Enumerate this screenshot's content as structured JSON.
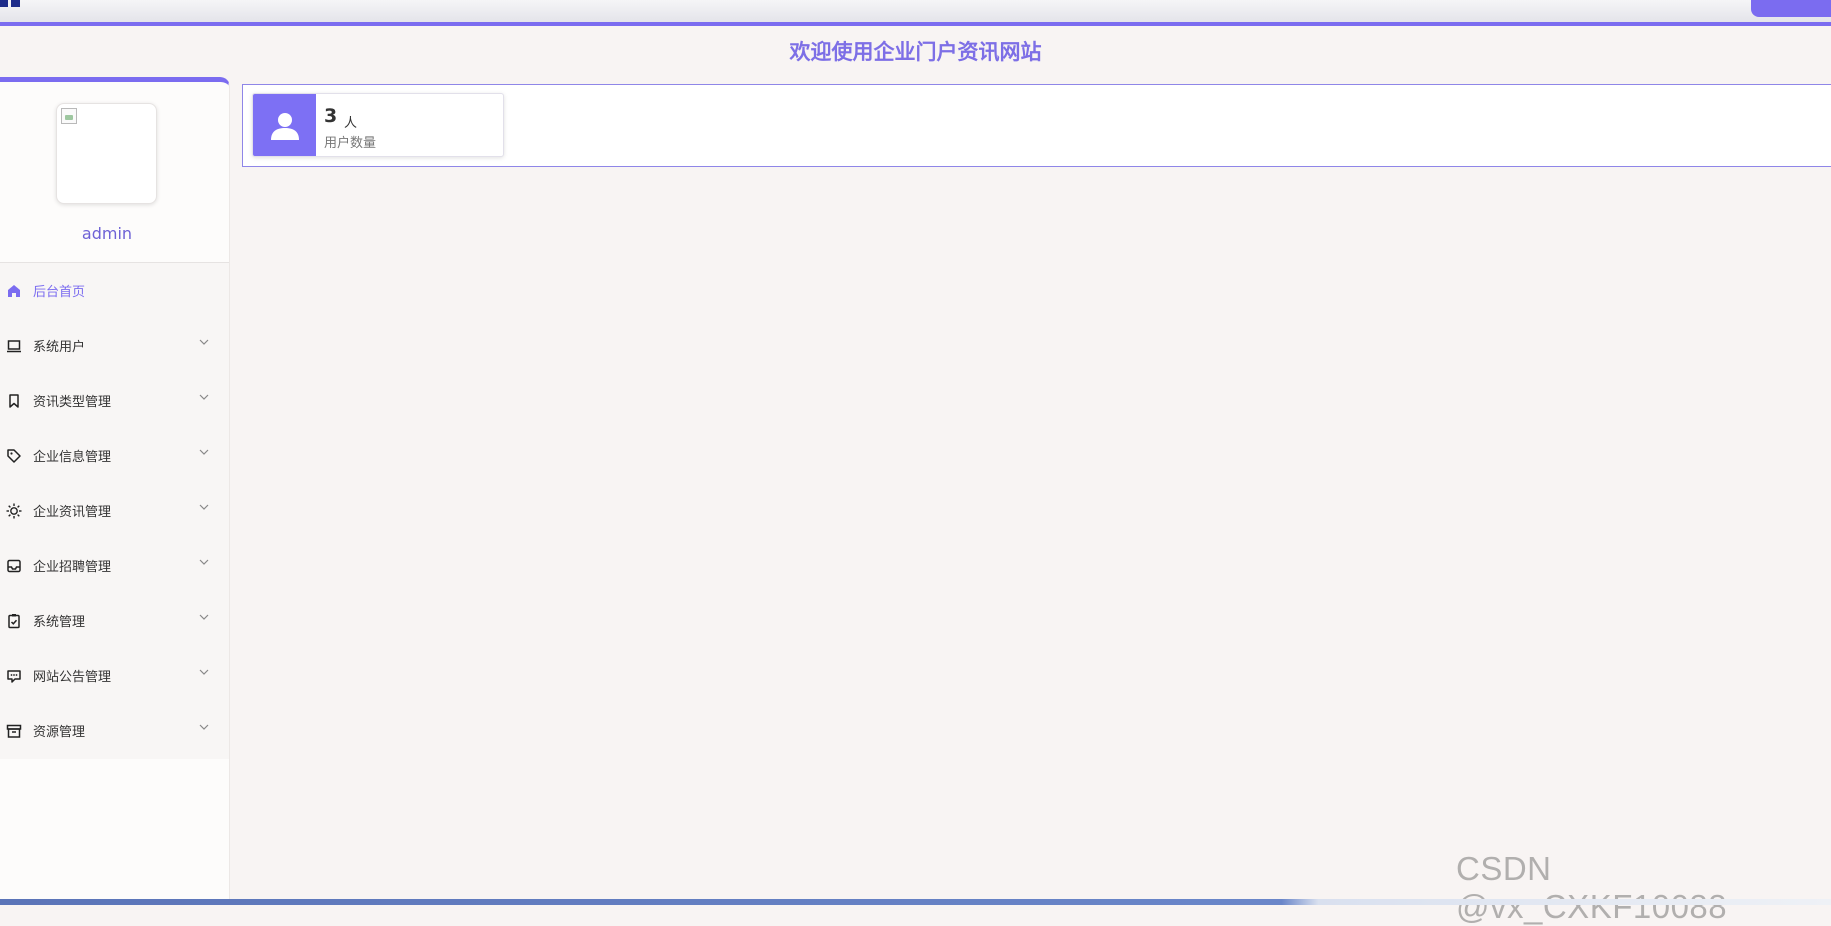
{
  "header": {
    "user_button_label": "",
    "welcome_title": "欢迎使用企业门户资讯网站"
  },
  "sidebar": {
    "username": "admin",
    "items": [
      {
        "label": "后台首页",
        "icon": "home-icon",
        "active": true
      },
      {
        "label": "系统用户",
        "icon": "laptop-icon"
      },
      {
        "label": "资讯类型管理",
        "icon": "bookmark-icon"
      },
      {
        "label": "企业信息管理",
        "icon": "tag-icon"
      },
      {
        "label": "企业资讯管理",
        "icon": "sun-icon"
      },
      {
        "label": "企业招聘管理",
        "icon": "inbox-icon"
      },
      {
        "label": "系统管理",
        "icon": "clipboard-check-icon"
      },
      {
        "label": "网站公告管理",
        "icon": "chat-icon"
      },
      {
        "label": "资源管理",
        "icon": "archive-icon"
      }
    ]
  },
  "stats": {
    "user_count": {
      "value": "3",
      "unit": "人",
      "label": "用户数量",
      "icon": "user-icon"
    }
  },
  "watermark": "CSDN @vx_CXKF10088",
  "colors": {
    "accent": "#7b6cf0",
    "title": "#7d6fe6",
    "background": "#f8f4f3"
  }
}
